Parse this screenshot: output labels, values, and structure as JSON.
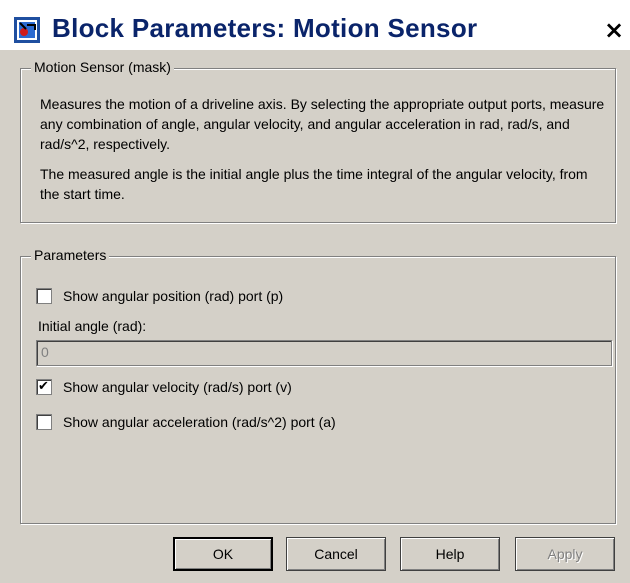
{
  "window": {
    "title": "Block Parameters: Motion Sensor",
    "close_glyph": "×",
    "icon": "simulink-block-icon"
  },
  "mask_group": {
    "legend": "Motion Sensor (mask)",
    "description_1": "Measures the motion of a driveline axis. By selecting the appropriate output ports, measure any combination of angle, angular velocity, and angular acceleration in rad, rad/s, and rad/s^2, respectively.",
    "description_2": "The measured angle is the initial angle plus the time integral of the angular velocity, from the start time."
  },
  "parameters": {
    "legend": "Parameters",
    "show_position": {
      "label": "Show angular position (rad) port (p)",
      "checked": false
    },
    "initial_angle": {
      "label": "Initial angle (rad):",
      "value": "0"
    },
    "show_velocity": {
      "label": "Show angular velocity (rad/s) port (v)",
      "checked": true
    },
    "show_acceleration": {
      "label": "Show angular acceleration (rad/s^2) port (a)",
      "checked": false
    }
  },
  "buttons": {
    "ok": "OK",
    "cancel": "Cancel",
    "help": "Help",
    "apply": "Apply"
  },
  "colors": {
    "title_text": "#0a246a",
    "dialog_face": "#d4d0c8"
  }
}
